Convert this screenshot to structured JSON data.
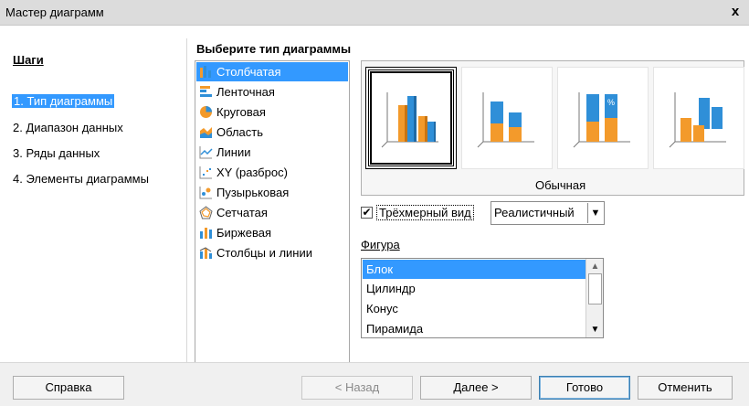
{
  "window": {
    "title": "Мастер диаграмм",
    "close_glyph": "x"
  },
  "steps": {
    "title": "Шаги",
    "items": [
      {
        "label": "1. Тип диаграммы",
        "active": true
      },
      {
        "label": "2. Диапазон данных",
        "active": false
      },
      {
        "label": "3. Ряды данных",
        "active": false
      },
      {
        "label": "4. Элементы диаграммы",
        "active": false
      }
    ]
  },
  "chart_type": {
    "heading": "Выберите тип диаграммы",
    "types": [
      {
        "label": "Столбчатая",
        "icon": "column-chart-icon",
        "selected": true
      },
      {
        "label": "Ленточная",
        "icon": "bar-chart-icon",
        "selected": false
      },
      {
        "label": "Круговая",
        "icon": "pie-chart-icon",
        "selected": false
      },
      {
        "label": "Область",
        "icon": "area-chart-icon",
        "selected": false
      },
      {
        "label": "Линии",
        "icon": "line-chart-icon",
        "selected": false
      },
      {
        "label": "XY (разброс)",
        "icon": "scatter-chart-icon",
        "selected": false
      },
      {
        "label": "Пузырьковая",
        "icon": "bubble-chart-icon",
        "selected": false
      },
      {
        "label": "Сетчатая",
        "icon": "net-chart-icon",
        "selected": false
      },
      {
        "label": "Биржевая",
        "icon": "stock-chart-icon",
        "selected": false
      },
      {
        "label": "Столбцы и линии",
        "icon": "column-line-chart-icon",
        "selected": false
      }
    ],
    "variant_caption": "Обычная",
    "variants": [
      {
        "name": "normal",
        "selected": true
      },
      {
        "name": "stacked",
        "selected": false
      },
      {
        "name": "percent-stacked",
        "selected": false,
        "badge": "%"
      },
      {
        "name": "deep",
        "selected": false
      }
    ]
  },
  "options": {
    "three_d_label": "Трёхмерный вид",
    "three_d_checked": true,
    "check_glyph": "✔",
    "scheme_value": "Реалистичный",
    "dropdown_glyph": "▼",
    "shape_label": "Фигура",
    "shapes": [
      {
        "label": "Блок",
        "selected": true
      },
      {
        "label": "Цилиндр",
        "selected": false
      },
      {
        "label": "Конус",
        "selected": false
      },
      {
        "label": "Пирамида",
        "selected": false
      }
    ],
    "scroll_up": "▲",
    "scroll_down": "▼"
  },
  "footer": {
    "help": "Справка",
    "back": "< Назад",
    "next": "Далее >",
    "finish": "Готово",
    "cancel": "Отменить"
  },
  "colors": {
    "selection": "#3399ff",
    "bar_blue": "#2f8fd8",
    "bar_orange": "#f39a2b"
  }
}
